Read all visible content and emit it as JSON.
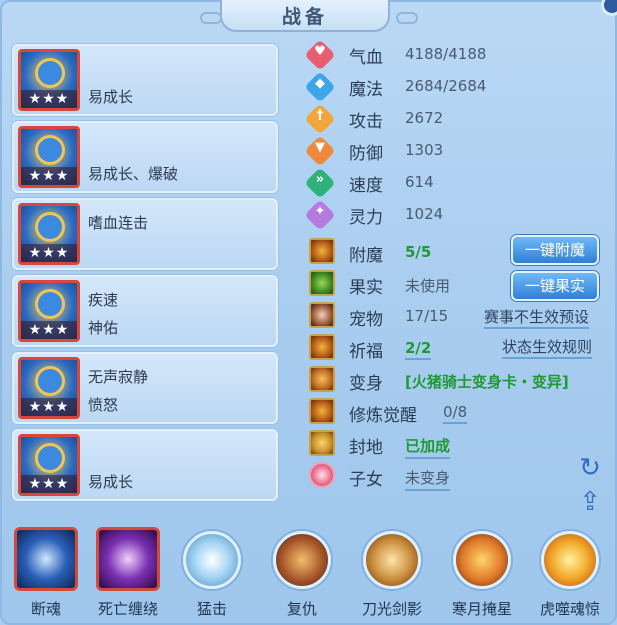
{
  "title": "战备",
  "cards": [
    {
      "line1": "",
      "line2": "易成长",
      "stars": "★★★"
    },
    {
      "line1": "",
      "line2": "易成长、爆破",
      "stars": "★★★"
    },
    {
      "line1": "嗜血连击",
      "line2": "",
      "stars": "★★★"
    },
    {
      "line1": "疾速",
      "line2": "神佑",
      "stars": "★★★"
    },
    {
      "line1": "无声寂静",
      "line2": "愤怒",
      "stars": "★★★"
    },
    {
      "line1": "",
      "line2": "易成长",
      "stars": "★★★"
    }
  ],
  "stats": [
    {
      "label": "气血",
      "value": "4188/4188",
      "color": "#e85d6f",
      "icon": "heart-icon"
    },
    {
      "label": "魔法",
      "value": "2684/2684",
      "color": "#3ea6e8",
      "icon": "mana-icon"
    },
    {
      "label": "攻击",
      "value": "2672",
      "color": "#f0a63a",
      "icon": "sword-icon"
    },
    {
      "label": "防御",
      "value": "1303",
      "color": "#f08a3a",
      "icon": "shield-icon"
    },
    {
      "label": "速度",
      "value": "614",
      "color": "#30b07a",
      "icon": "speed-icon"
    },
    {
      "label": "灵力",
      "value": "1024",
      "color": "#b57ae0",
      "icon": "spirit-icon"
    }
  ],
  "rows": [
    {
      "label": "附魔",
      "value": "5/5",
      "icon": "enchant-icon"
    },
    {
      "label": "果实",
      "value": "未使用",
      "icon": "fruit-icon"
    },
    {
      "label": "宠物",
      "value": "17/15",
      "icon": "pet-icon"
    },
    {
      "label": "祈福",
      "value": "2/2",
      "icon": "blessing-icon"
    },
    {
      "label": "变身",
      "value": "[火猪骑士变身卡・变异]",
      "icon": "transform-icon"
    },
    {
      "label": "修炼觉醒",
      "value": "0/8",
      "icon": "cultivation-icon"
    },
    {
      "label": "封地",
      "value": "已加成",
      "icon": "fief-icon"
    },
    {
      "label": "子女",
      "value": "未变身",
      "icon": "child-icon"
    }
  ],
  "buttons": {
    "enchant": "一键附魔",
    "fruit": "一键果实"
  },
  "links": {
    "pet": "赛事不生效预设",
    "blessing": "状态生效规则"
  },
  "skills": [
    {
      "name": "断魂",
      "shape": "square"
    },
    {
      "name": "死亡缠绕",
      "shape": "square"
    },
    {
      "name": "猛击",
      "shape": "round"
    },
    {
      "name": "复仇",
      "shape": "round"
    },
    {
      "name": "刀光剑影",
      "shape": "round"
    },
    {
      "name": "寒月掩星",
      "shape": "round"
    },
    {
      "name": "虎噬魂惊",
      "shape": "round"
    }
  ]
}
